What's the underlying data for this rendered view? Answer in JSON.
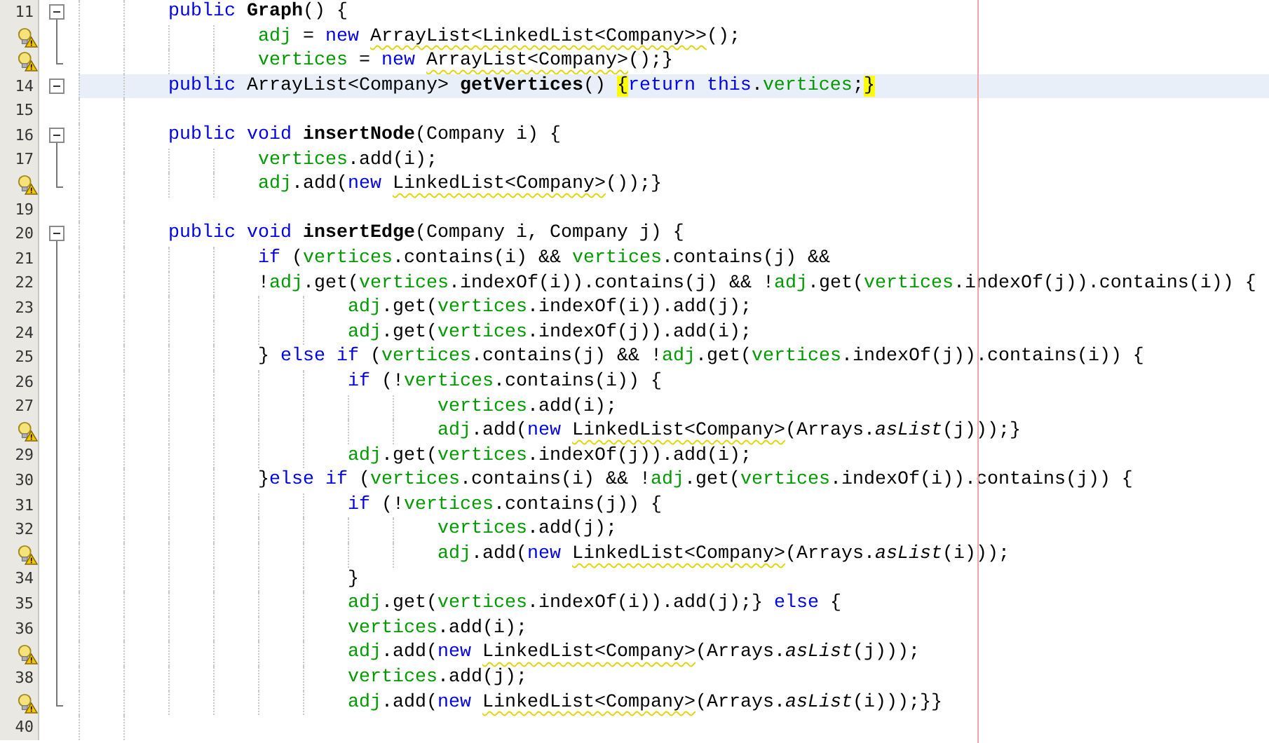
{
  "editor": {
    "lines": [
      {
        "number": "11",
        "hint": false,
        "foldable": true,
        "fold_above": false,
        "fold_below": true,
        "current": false,
        "tokens": [
          {
            "text": "public ",
            "kind": "keyword"
          },
          {
            "text": "Graph",
            "kind": "method"
          },
          {
            "text": "() {",
            "kind": "plain"
          }
        ],
        "children": [
          {
            "hint": true,
            "foldable": false,
            "fold_above": true,
            "fold_below": true,
            "current": false,
            "tokens": [
              {
                "text": "adj",
                "kind": "field"
              },
              {
                "text": " = ",
                "kind": "plain"
              },
              {
                "text": "new ",
                "kind": "keyword"
              },
              {
                "text": "ArrayList<LinkedList<Company>>",
                "kind": "warning"
              },
              {
                "text": "();",
                "kind": "plain"
              }
            ]
          },
          {
            "hint": true,
            "foldable": false,
            "fold_above": true,
            "fold_below": false,
            "current": false,
            "tokens": [
              {
                "text": "vertices",
                "kind": "field"
              },
              {
                "text": " = ",
                "kind": "plain"
              },
              {
                "text": "new ",
                "kind": "keyword"
              },
              {
                "text": "ArrayList<Company>",
                "kind": "warning"
              },
              {
                "text": "();}",
                "kind": "plain"
              }
            ]
          }
        ]
      },
      {
        "number": "14",
        "hint": false,
        "foldable": true,
        "fold_above": false,
        "fold_below": false,
        "current": true,
        "tokens": [
          {
            "text": "public",
            "kind": "keyword"
          },
          {
            "text": " ArrayList<Company> ",
            "kind": "plain"
          },
          {
            "text": "getVertices",
            "kind": "method"
          },
          {
            "text": "() ",
            "kind": "plain"
          },
          {
            "text": "{",
            "kind": "match"
          },
          {
            "text": "return this",
            "kind": "keyword"
          },
          {
            "text": ".",
            "kind": "plain"
          },
          {
            "text": "vertices",
            "kind": "field"
          },
          {
            "text": ";",
            "kind": "plain"
          },
          {
            "text": "}",
            "kind": "match"
          }
        ]
      },
      {
        "number": "15",
        "hint": false,
        "foldable": false,
        "fold_above": false,
        "fold_below": false,
        "current": false
      },
      {
        "number": "16",
        "hint": false,
        "foldable": true,
        "fold_above": false,
        "fold_below": true,
        "current": false,
        "tokens": [
          {
            "text": "public void ",
            "kind": "keyword"
          },
          {
            "text": "insertNode",
            "kind": "method"
          },
          {
            "text": "(Company i) {",
            "kind": "plain"
          }
        ],
        "children": [
          {
            "number": "17",
            "hint": false,
            "foldable": false,
            "fold_above": true,
            "fold_below": true,
            "current": false,
            "tokens": [
              {
                "text": "vertices",
                "kind": "field"
              },
              {
                "text": ".add(i);",
                "kind": "plain"
              }
            ]
          },
          {
            "hint": true,
            "foldable": false,
            "fold_above": true,
            "fold_below": false,
            "current": false,
            "tokens": [
              {
                "text": "adj",
                "kind": "field"
              },
              {
                "text": ".add(",
                "kind": "plain"
              },
              {
                "text": "new ",
                "kind": "keyword"
              },
              {
                "text": "LinkedList<Company>",
                "kind": "warning"
              },
              {
                "text": "());}",
                "kind": "plain"
              }
            ]
          }
        ]
      },
      {
        "number": "19",
        "hint": false,
        "foldable": false,
        "fold_above": false,
        "fold_below": false,
        "current": false
      },
      {
        "number": "20",
        "hint": false,
        "foldable": true,
        "fold_above": false,
        "fold_below": true,
        "current": false,
        "tokens": [
          {
            "text": "public void ",
            "kind": "keyword"
          },
          {
            "text": "insertEdge",
            "kind": "method"
          },
          {
            "text": "(Company i, Company j) {",
            "kind": "plain"
          }
        ],
        "children": [
          {
            "number": "21",
            "hint": false,
            "foldable": false,
            "fold_above": true,
            "fold_below": true,
            "current": false,
            "tokens": [
              {
                "text": "if",
                "kind": "keyword"
              },
              {
                "text": " (",
                "kind": "plain"
              },
              {
                "text": "vertices",
                "kind": "field"
              },
              {
                "text": ".contains(i) && ",
                "kind": "plain"
              },
              {
                "text": "vertices",
                "kind": "field"
              },
              {
                "text": ".contains(j) &&",
                "kind": "plain"
              }
            ]
          },
          {
            "number": "22",
            "hint": false,
            "foldable": false,
            "fold_above": true,
            "fold_below": true,
            "current": false,
            "tokens": [
              {
                "text": "!",
                "kind": "plain"
              },
              {
                "text": "adj",
                "kind": "field"
              },
              {
                "text": ".get(",
                "kind": "plain"
              },
              {
                "text": "vertices",
                "kind": "field"
              },
              {
                "text": ".indexOf(i)).contains(j) && !",
                "kind": "plain"
              },
              {
                "text": "adj",
                "kind": "field"
              },
              {
                "text": ".get(",
                "kind": "plain"
              },
              {
                "text": "vertices",
                "kind": "field"
              },
              {
                "text": ".indexOf(j)).contains(i)) {",
                "kind": "plain"
              }
            ],
            "children": [
              {
                "number": "23",
                "hint": false,
                "foldable": false,
                "fold_above": true,
                "fold_below": true,
                "current": false,
                "tokens": [
                  {
                    "text": "adj",
                    "kind": "field"
                  },
                  {
                    "text": ".get(",
                    "kind": "plain"
                  },
                  {
                    "text": "vertices",
                    "kind": "field"
                  },
                  {
                    "text": ".indexOf(i)).add(j);",
                    "kind": "plain"
                  }
                ]
              },
              {
                "number": "24",
                "hint": false,
                "foldable": false,
                "fold_above": true,
                "fold_below": true,
                "current": false,
                "tokens": [
                  {
                    "text": "adj",
                    "kind": "field"
                  },
                  {
                    "text": ".get(",
                    "kind": "plain"
                  },
                  {
                    "text": "vertices",
                    "kind": "field"
                  },
                  {
                    "text": ".indexOf(j)).add(i);",
                    "kind": "plain"
                  }
                ]
              }
            ]
          },
          {
            "number": "25",
            "hint": false,
            "foldable": false,
            "fold_above": true,
            "fold_below": true,
            "current": false,
            "tokens": [
              {
                "text": "} ",
                "kind": "plain"
              },
              {
                "text": "else if",
                "kind": "keyword"
              },
              {
                "text": " (",
                "kind": "plain"
              },
              {
                "text": "vertices",
                "kind": "field"
              },
              {
                "text": ".contains(j) && !",
                "kind": "plain"
              },
              {
                "text": "adj",
                "kind": "field"
              },
              {
                "text": ".get(",
                "kind": "plain"
              },
              {
                "text": "vertices",
                "kind": "field"
              },
              {
                "text": ".indexOf(j)).contains(i)) {",
                "kind": "plain"
              }
            ],
            "children": [
              {
                "number": "26",
                "hint": false,
                "foldable": false,
                "fold_above": true,
                "fold_below": true,
                "current": false,
                "tokens": [
                  {
                    "text": "if",
                    "kind": "keyword"
                  },
                  {
                    "text": " (!",
                    "kind": "plain"
                  },
                  {
                    "text": "vertices",
                    "kind": "field"
                  },
                  {
                    "text": ".contains(i)) {",
                    "kind": "plain"
                  }
                ],
                "children": [
                  {
                    "number": "27",
                    "hint": false,
                    "foldable": false,
                    "fold_above": true,
                    "fold_below": true,
                    "current": false,
                    "tokens": [
                      {
                        "text": "vertices",
                        "kind": "field"
                      },
                      {
                        "text": ".add(i);",
                        "kind": "plain"
                      }
                    ]
                  },
                  {
                    "hint": true,
                    "foldable": false,
                    "fold_above": true,
                    "fold_below": true,
                    "current": false,
                    "tokens": [
                      {
                        "text": "adj",
                        "kind": "field"
                      },
                      {
                        "text": ".add(",
                        "kind": "plain"
                      },
                      {
                        "text": "new ",
                        "kind": "keyword"
                      },
                      {
                        "text": "LinkedList<Company>",
                        "kind": "warning"
                      },
                      {
                        "text": "(Arrays.",
                        "kind": "plain"
                      },
                      {
                        "text": "asList",
                        "kind": "static"
                      },
                      {
                        "text": "(j)));}",
                        "kind": "plain"
                      }
                    ]
                  }
                ]
              },
              {
                "number": "29",
                "hint": false,
                "foldable": false,
                "fold_above": true,
                "fold_below": true,
                "current": false,
                "tokens": [
                  {
                    "text": "adj",
                    "kind": "field"
                  },
                  {
                    "text": ".get(",
                    "kind": "plain"
                  },
                  {
                    "text": "vertices",
                    "kind": "field"
                  },
                  {
                    "text": ".indexOf(j)).add(i);",
                    "kind": "plain"
                  }
                ]
              }
            ]
          },
          {
            "number": "30",
            "hint": false,
            "foldable": false,
            "fold_above": true,
            "fold_below": true,
            "current": false,
            "tokens": [
              {
                "text": "}",
                "kind": "plain"
              },
              {
                "text": "else if",
                "kind": "keyword"
              },
              {
                "text": " (",
                "kind": "plain"
              },
              {
                "text": "vertices",
                "kind": "field"
              },
              {
                "text": ".contains(i) && !",
                "kind": "plain"
              },
              {
                "text": "adj",
                "kind": "field"
              },
              {
                "text": ".get(",
                "kind": "plain"
              },
              {
                "text": "vertices",
                "kind": "field"
              },
              {
                "text": ".indexOf(i)).contains(j)) {",
                "kind": "plain"
              }
            ],
            "children": [
              {
                "number": "31",
                "hint": false,
                "foldable": false,
                "fold_above": true,
                "fold_below": true,
                "current": false,
                "tokens": [
                  {
                    "text": "if",
                    "kind": "keyword"
                  },
                  {
                    "text": " (!",
                    "kind": "plain"
                  },
                  {
                    "text": "vertices",
                    "kind": "field"
                  },
                  {
                    "text": ".contains(j)) {",
                    "kind": "plain"
                  }
                ],
                "children": [
                  {
                    "number": "32",
                    "hint": false,
                    "foldable": false,
                    "fold_above": true,
                    "fold_below": true,
                    "current": false,
                    "tokens": [
                      {
                        "text": "vertices",
                        "kind": "field"
                      },
                      {
                        "text": ".add(j);",
                        "kind": "plain"
                      }
                    ]
                  },
                  {
                    "hint": true,
                    "foldable": false,
                    "fold_above": true,
                    "fold_below": true,
                    "current": false,
                    "tokens": [
                      {
                        "text": "adj",
                        "kind": "field"
                      },
                      {
                        "text": ".add(",
                        "kind": "plain"
                      },
                      {
                        "text": "new ",
                        "kind": "keyword"
                      },
                      {
                        "text": "LinkedList<Company>",
                        "kind": "warning"
                      },
                      {
                        "text": "(Arrays.",
                        "kind": "plain"
                      },
                      {
                        "text": "asList",
                        "kind": "static"
                      },
                      {
                        "text": "(i)));",
                        "kind": "plain"
                      }
                    ]
                  }
                ]
              },
              {
                "number": "34",
                "hint": false,
                "foldable": false,
                "fold_above": true,
                "fold_below": true,
                "current": false,
                "tokens": [
                  {
                    "text": "}",
                    "kind": "plain"
                  }
                ]
              },
              {
                "number": "35",
                "hint": false,
                "foldable": false,
                "fold_above": true,
                "fold_below": true,
                "current": false,
                "tokens": [
                  {
                    "text": "adj",
                    "kind": "field"
                  },
                  {
                    "text": ".get(",
                    "kind": "plain"
                  },
                  {
                    "text": "vertices",
                    "kind": "field"
                  },
                  {
                    "text": ".indexOf(i)).add(j);} ",
                    "kind": "plain"
                  },
                  {
                    "text": "else",
                    "kind": "keyword"
                  },
                  {
                    "text": " {",
                    "kind": "plain"
                  }
                ]
              },
              {
                "number": "36",
                "hint": false,
                "foldable": false,
                "fold_above": true,
                "fold_below": true,
                "current": false,
                "tokens": [
                  {
                    "text": "vertices",
                    "kind": "field"
                  },
                  {
                    "text": ".add(i);",
                    "kind": "plain"
                  }
                ]
              },
              {
                "hint": true,
                "foldable": false,
                "fold_above": true,
                "fold_below": true,
                "current": false,
                "tokens": [
                  {
                    "text": "adj",
                    "kind": "field"
                  },
                  {
                    "text": ".add(",
                    "kind": "plain"
                  },
                  {
                    "text": "new ",
                    "kind": "keyword"
                  },
                  {
                    "text": "LinkedList<Company>",
                    "kind": "warning"
                  },
                  {
                    "text": "(Arrays.",
                    "kind": "plain"
                  },
                  {
                    "text": "asList",
                    "kind": "static"
                  },
                  {
                    "text": "(j)));",
                    "kind": "plain"
                  }
                ]
              },
              {
                "number": "38",
                "hint": false,
                "foldable": false,
                "fold_above": true,
                "fold_below": true,
                "current": false,
                "tokens": [
                  {
                    "text": "vertices",
                    "kind": "field"
                  },
                  {
                    "text": ".add(j);",
                    "kind": "plain"
                  }
                ]
              },
              {
                "hint": true,
                "foldable": false,
                "fold_above": true,
                "fold_below": false,
                "current": false,
                "tokens": [
                  {
                    "text": "adj",
                    "kind": "field"
                  },
                  {
                    "text": ".add(",
                    "kind": "plain"
                  },
                  {
                    "text": "new ",
                    "kind": "keyword"
                  },
                  {
                    "text": "LinkedList<Company>",
                    "kind": "warning"
                  },
                  {
                    "text": "(Arrays.",
                    "kind": "plain"
                  },
                  {
                    "text": "asList",
                    "kind": "static"
                  },
                  {
                    "text": "(i)));}}",
                    "kind": "plain"
                  }
                ]
              }
            ]
          }
        ]
      },
      {
        "number": "40",
        "hint": false,
        "foldable": false,
        "fold_above": false,
        "fold_below": false,
        "current": false
      }
    ]
  }
}
